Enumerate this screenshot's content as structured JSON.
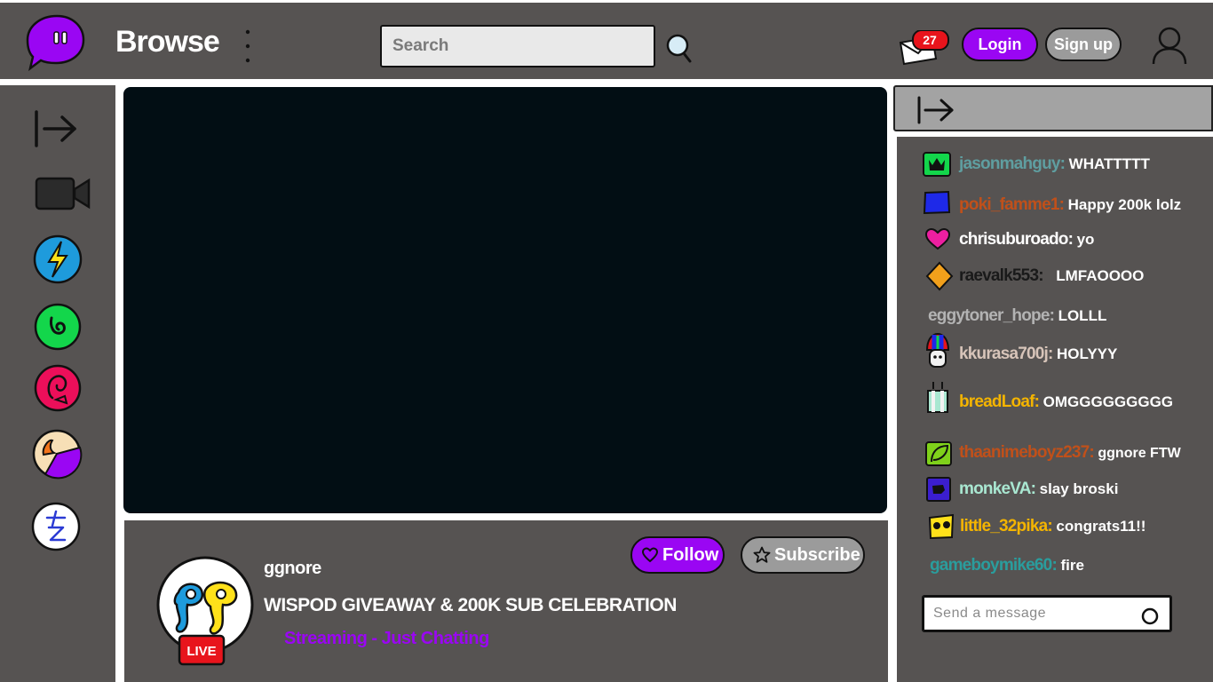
{
  "header": {
    "title": "Browse",
    "search_placeholder": "Search",
    "notification_count": "27",
    "login_label": "Login",
    "signup_label": "Sign up"
  },
  "sidebar": {
    "icons": [
      "expand-arrow-icon",
      "video-camera-icon",
      "lightning-icon",
      "spiral-icon",
      "face-icon",
      "pizza-icon",
      "kanji-icon"
    ]
  },
  "stream": {
    "streamer": "ggnore",
    "title": "WISPOD GIVEAWAY & 200K SUB CELEBRATION",
    "category": "Streaming - Just Chatting",
    "live_label": "LIVE",
    "follow_label": "Follow",
    "subscribe_label": "Subscribe"
  },
  "chat": {
    "messages": [
      {
        "user": "jasonmahguy:",
        "text": "WHATTTTT",
        "color": "#5f9ea0"
      },
      {
        "user": "poki_famme1:",
        "text": "Happy 200k lolz",
        "color": "#c0501a"
      },
      {
        "user": "chrisuburoado:",
        "text": "yo",
        "color": "#ffffff"
      },
      {
        "user": "raevalk553:",
        "text": "LMFAOOOO",
        "color": "#1a1a1a"
      },
      {
        "user": "eggytoner_hope:",
        "text": "LOLLL",
        "color": "#b3b3b3"
      },
      {
        "user": "kkurasa700j:",
        "text": "HOLYYY",
        "color": "#d7c4b9"
      },
      {
        "user": "breadLoaf:",
        "text": "OMGGGGGGGGG",
        "color": "#f4b400"
      },
      {
        "user": "thaanimeboyz237:",
        "text": "ggnore FTW",
        "color": "#c0501a"
      },
      {
        "user": "monkeVA:",
        "text": "slay broski",
        "color": "#a9e7d1"
      },
      {
        "user": "little_32pika:",
        "text": "congrats11!!",
        "color": "#f4b400"
      },
      {
        "user": "gameboymike60:",
        "text": "fire",
        "color": "#2a9d9d"
      }
    ],
    "input_placeholder": "Send a message"
  },
  "colors": {
    "accent": "#9a06f3",
    "panel": "#565352",
    "video_bg": "#020e14",
    "notification": "#e8141c"
  }
}
